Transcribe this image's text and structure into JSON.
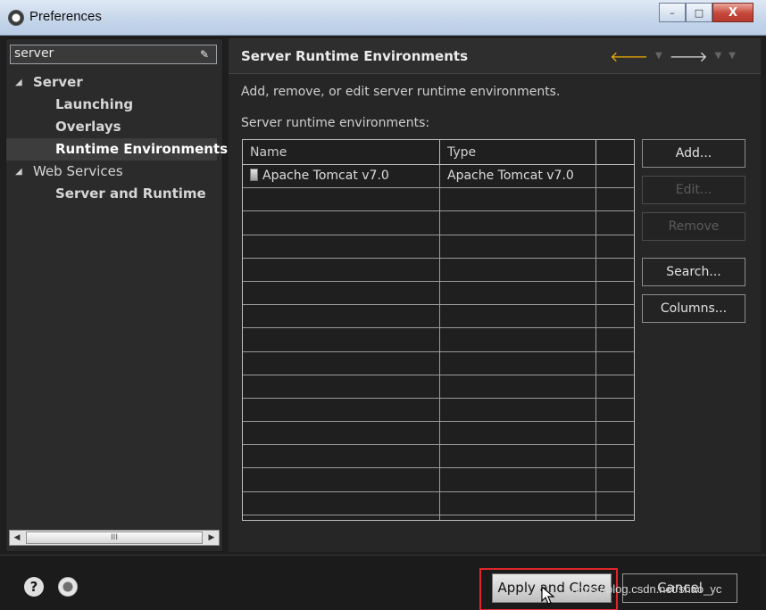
{
  "window": {
    "title": "Preferences",
    "buttons": {
      "minimize": "–",
      "maximize": "□",
      "close": "X"
    }
  },
  "left": {
    "filter_value": "server",
    "tree": [
      {
        "label": "Server",
        "expanded": true,
        "bold": true
      },
      {
        "label": "Launching",
        "bold": true
      },
      {
        "label": "Overlays",
        "bold": true
      },
      {
        "label": "Runtime Environments",
        "bold": true,
        "selected": true
      },
      {
        "label": "Web Services",
        "expanded": true,
        "bold": false
      },
      {
        "label": "Server and Runtime",
        "bold": true
      }
    ],
    "scroll_thumb": "III"
  },
  "right": {
    "title": "Server Runtime Environments",
    "description": "Add, remove, or edit server runtime environments.",
    "sublabel": "Server runtime environments:",
    "table": {
      "headers": [
        "Name",
        "Type"
      ],
      "rows": [
        {
          "name": "Apache Tomcat v7.0",
          "type": "Apache Tomcat v7.0"
        }
      ]
    },
    "buttons": {
      "add": "Add...",
      "edit": "Edit...",
      "remove": "Remove",
      "search": "Search...",
      "columns": "Columns..."
    }
  },
  "bottom": {
    "help": "?",
    "apply_close": "Apply and Close",
    "cancel": "Cancel",
    "watermark": "https://blog.csdn.net/shao_yc"
  },
  "colors": {
    "highlight": "#e0262b",
    "nav_back": "#f0b000"
  }
}
